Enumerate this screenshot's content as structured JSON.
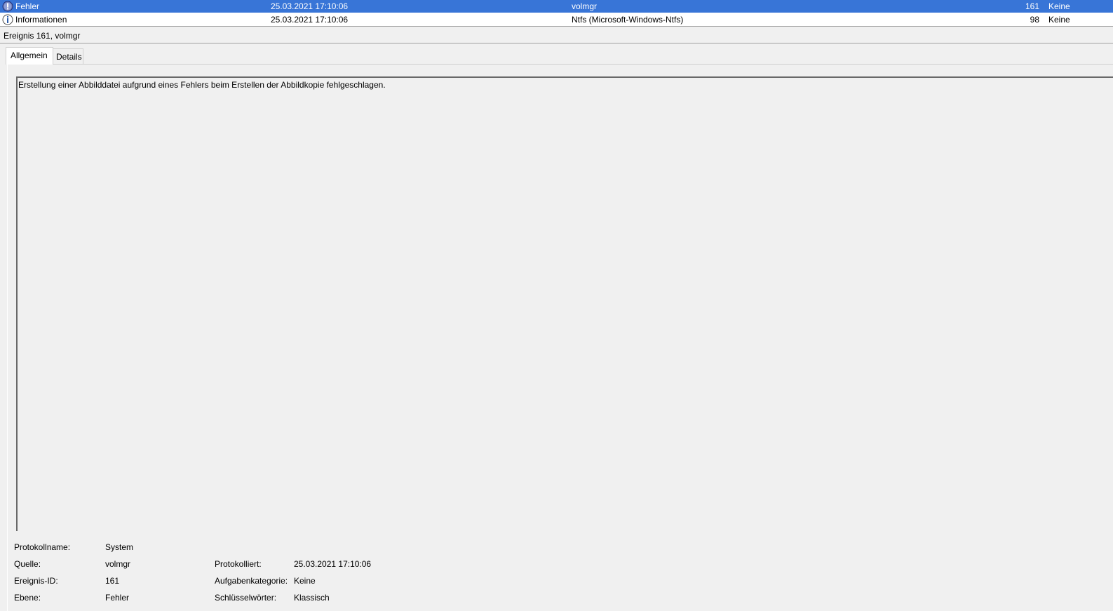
{
  "event_list": {
    "rows": [
      {
        "icon": "error-icon",
        "level": "Fehler",
        "date": "25.03.2021 17:10:06",
        "source": "volmgr",
        "event_id": "161",
        "category": "Keine",
        "selected": true
      },
      {
        "icon": "info-icon",
        "level": "Informationen",
        "date": "25.03.2021 17:10:06",
        "source": "Ntfs (Microsoft-Windows-Ntfs)",
        "event_id": "98",
        "category": "Keine",
        "selected": false
      }
    ]
  },
  "detail": {
    "header": "Ereignis 161, volmgr",
    "tabs": [
      {
        "label": "Allgemein",
        "active": true
      },
      {
        "label": "Details",
        "active": false
      }
    ],
    "message": "Erstellung einer Abbilddatei aufgrund eines Fehlers beim Erstellen der Abbildkopie fehlgeschlagen.",
    "properties": {
      "log_name_label": "Protokollname:",
      "log_name_value": "System",
      "source_label": "Quelle:",
      "source_value": "volmgr",
      "logged_label": "Protokolliert:",
      "logged_value": "25.03.2021 17:10:06",
      "event_id_label": "Ereignis-ID:",
      "event_id_value": "161",
      "task_category_label": "Aufgabenkategorie:",
      "task_category_value": "Keine",
      "level_label": "Ebene:",
      "level_value": "Fehler",
      "keywords_label": "Schlüsselwörter:",
      "keywords_value": "Klassisch"
    }
  },
  "colors": {
    "selection": "#3875d7",
    "panel_bg": "#f0f0f0"
  }
}
